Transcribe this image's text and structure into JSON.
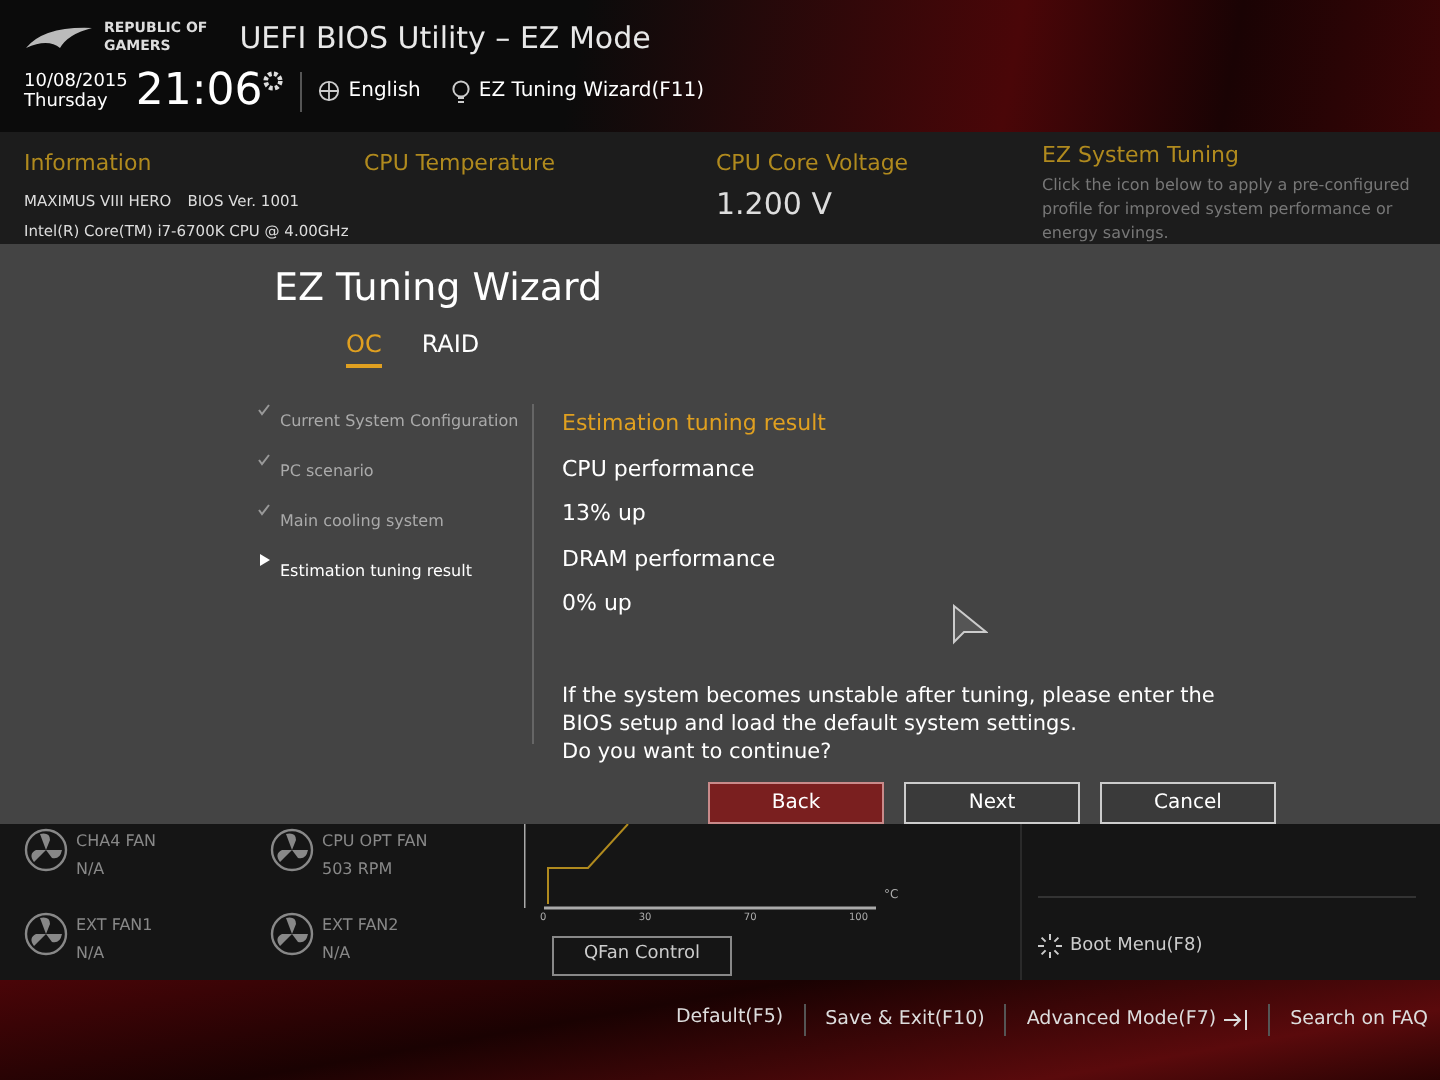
{
  "header": {
    "brand_line1": "REPUBLIC OF",
    "brand_line2": "GAMERS",
    "title": "UEFI BIOS Utility – EZ Mode",
    "date": "10/08/2015",
    "day": "Thursday",
    "time": "21:06",
    "language": "English",
    "wizard_link": "EZ Tuning Wizard(F11)"
  },
  "info": {
    "title": "Information",
    "board": "MAXIMUS VIII HERO",
    "bios": "BIOS Ver. 1001",
    "cpu": "Intel(R) Core(TM) i7-6700K CPU @ 4.00GHz",
    "cpu_temp_title": "CPU Temperature",
    "voltage_title": "CPU Core Voltage",
    "voltage": "1.200 V",
    "tuning_title": "EZ System Tuning",
    "tuning_text": "Click the icon below to apply a pre-configured profile for improved system performance or energy savings."
  },
  "dialog": {
    "title": "EZ Tuning Wizard",
    "tabs": [
      {
        "label": "OC",
        "selected": true
      },
      {
        "label": "RAID",
        "selected": false
      }
    ],
    "steps": [
      {
        "label": "Current System Configuration",
        "kind": "done"
      },
      {
        "label": "PC scenario",
        "kind": "done"
      },
      {
        "label": "Main cooling system",
        "kind": "done"
      },
      {
        "label": "Estimation tuning result",
        "kind": "current"
      }
    ],
    "result_title": "Estimation tuning result",
    "results": [
      "CPU performance",
      "13% up",
      "DRAM performance",
      "0% up"
    ],
    "message": [
      "If the system becomes unstable after tuning, please enter the",
      "BIOS setup and load the default system settings.",
      "Do you want to continue?"
    ],
    "buttons": [
      {
        "label": "Back",
        "selected": true
      },
      {
        "label": "Next",
        "selected": false
      },
      {
        "label": "Cancel",
        "selected": false
      }
    ]
  },
  "fans": [
    {
      "name": "CHA4 FAN",
      "value": "N/A"
    },
    {
      "name": "CPU OPT FAN",
      "value": "503 RPM"
    },
    {
      "name": "EXT FAN1",
      "value": "N/A"
    },
    {
      "name": "EXT FAN2",
      "value": "N/A"
    }
  ],
  "fan_chart": {
    "unit": "°C",
    "ticks": [
      "0",
      "30",
      "70",
      "100"
    ],
    "button": "QFan Control"
  },
  "boot_menu": "Boot Menu(F8)",
  "footer": [
    "Default(F5)",
    "Save & Exit(F10)",
    "Advanced Mode(F7)",
    "Search on FAQ"
  ]
}
